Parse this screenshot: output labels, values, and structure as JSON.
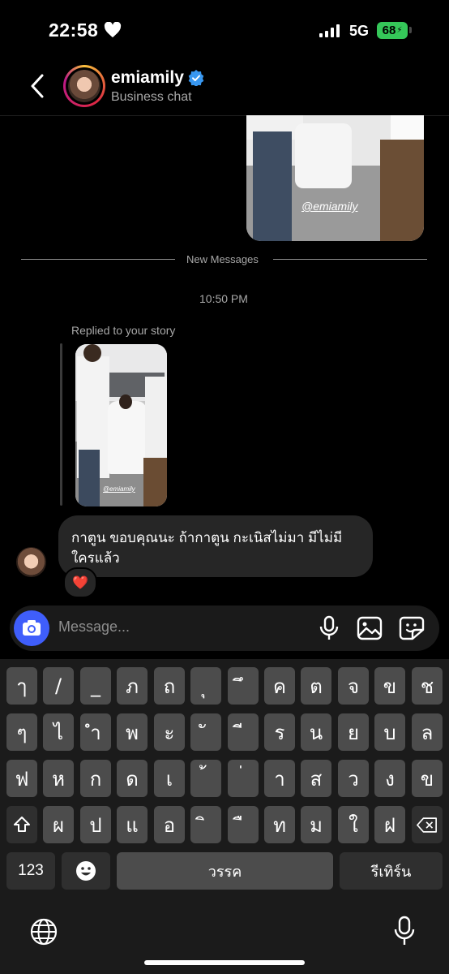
{
  "status_bar": {
    "time": "22:58",
    "network": "5G",
    "battery": "68"
  },
  "header": {
    "username": "emiamily",
    "subtitle": "Business chat"
  },
  "story_preview": {
    "tag": "@emiamily"
  },
  "conversation": {
    "divider_label": "New Messages",
    "timestamp": "10:50 PM",
    "replied_label": "Replied to your story",
    "story_thumb_tag": "@emiamily",
    "message_text": "กาตูน ขอบคุณนะ ถ้ากาตูน กะเนิสไม่มา มีไม่มี ใครแล้ว",
    "reaction": "❤️"
  },
  "composer": {
    "placeholder": "Message..."
  },
  "keyboard": {
    "row1": [
      "ๅ",
      "/",
      "_",
      "ภ",
      "ถ",
      "ุ",
      "ึ",
      "ค",
      "ต",
      "จ",
      "ข",
      "ช"
    ],
    "row2": [
      "ๆ",
      "ไ",
      "ำ",
      "พ",
      "ะ",
      "ั",
      "ี",
      "ร",
      "น",
      "ย",
      "บ",
      "ล"
    ],
    "row3": [
      "ฟ",
      "ห",
      "ก",
      "ด",
      "เ",
      "้",
      "่",
      "า",
      "ส",
      "ว",
      "ง",
      "ข"
    ],
    "row4": [
      "ผ",
      "ป",
      "แ",
      "อ",
      "ิ",
      "ื",
      "ท",
      "ม",
      "ใ",
      "ฝ"
    ],
    "numbers_key": "123",
    "space_key": "วรรค",
    "return_key": "รีเทิร์น"
  },
  "colors": {
    "accent": "#3f5efb",
    "battery": "#35c759",
    "bubble": "#262626",
    "verified": "#3897f0"
  }
}
